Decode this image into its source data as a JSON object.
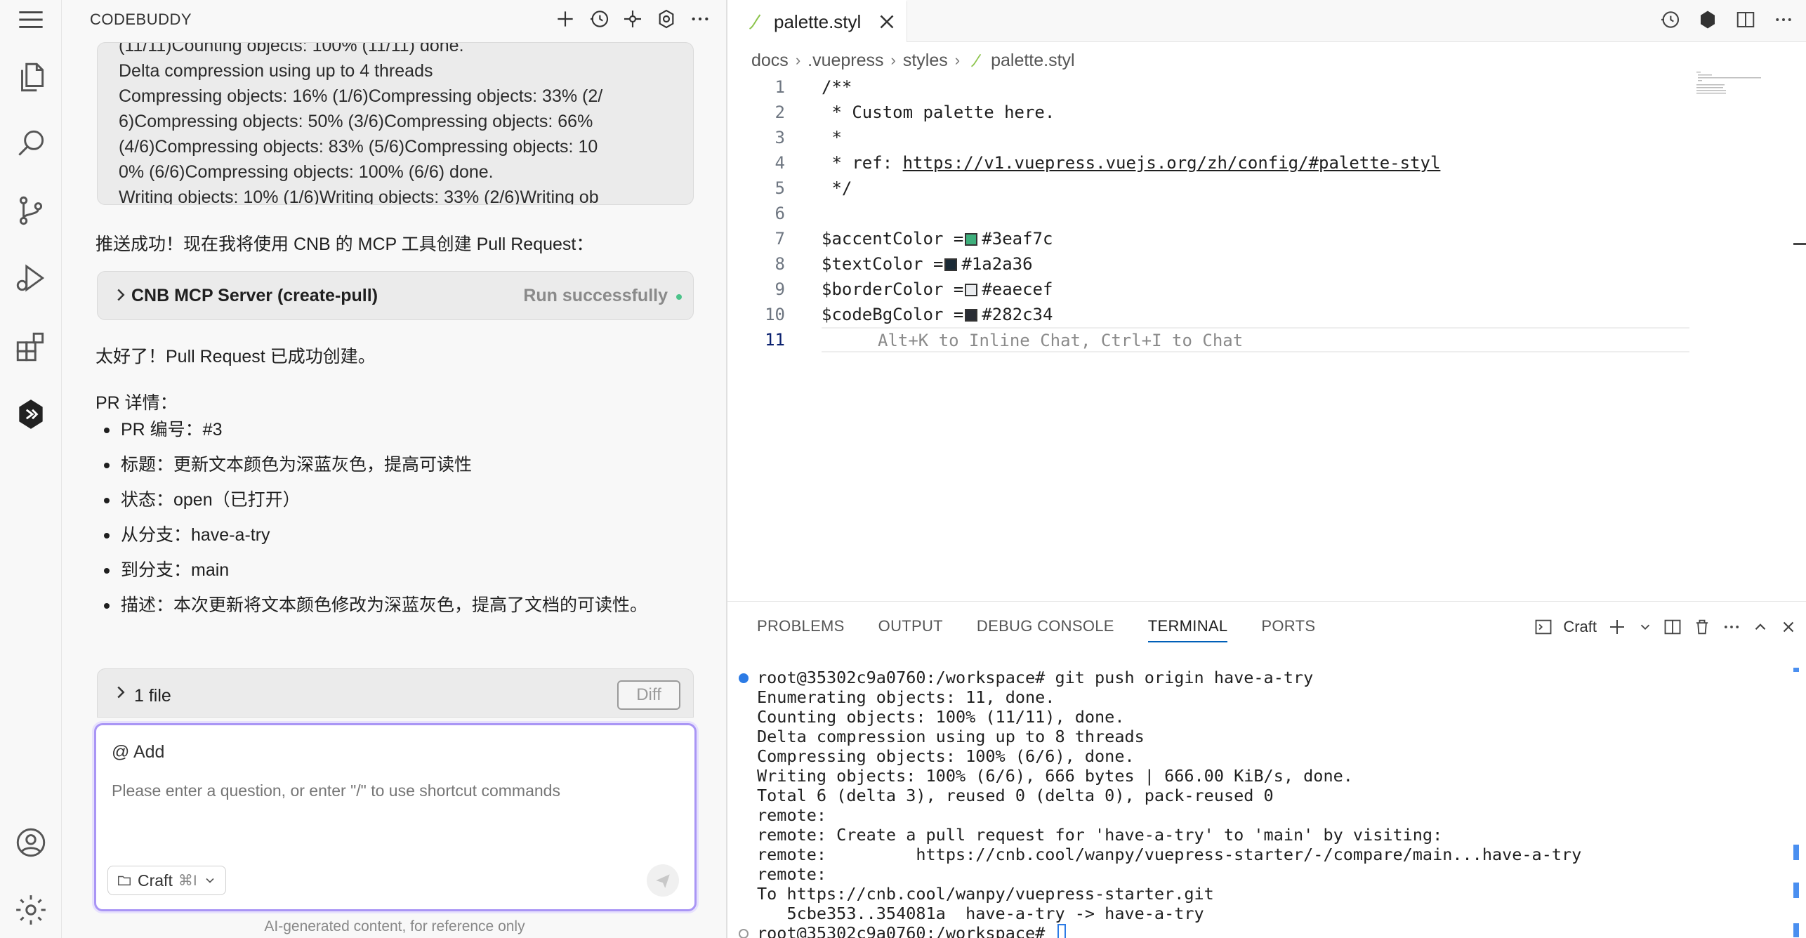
{
  "activity_bar": {
    "icons": [
      "menu-icon",
      "explorer-icon",
      "search-icon",
      "source-control-icon",
      "run-debug-icon",
      "extensions-icon",
      "codebuddy-icon",
      "account-icon",
      "settings-icon"
    ]
  },
  "chat": {
    "title": "CODEBUDDY",
    "header_icons": [
      "add-icon",
      "history-icon",
      "mcp-icon",
      "settings-icon",
      "more-icon"
    ],
    "git_output_lines": [
      "(11/11)Counting objects: 100% (11/11) done.",
      "Delta compression using up to 4 threads",
      "Compressing objects:  16% (1/6)Compressing objects:  33% (2/",
      "6)Compressing objects:  50% (3/6)Compressing objects:  66%",
      "(4/6)Compressing objects:  83% (5/6)Compressing objects: 10",
      "0% (6/6)Compressing objects: 100% (6/6) done.",
      "Writing objects:  10% (1/6)Writing objects:  33% (2/6)Writing ob"
    ],
    "push_message": "推送成功！现在我将使用 CNB 的 MCP 工具创建 Pull Request：",
    "tool_call": {
      "name": "CNB MCP Server (create-pull)",
      "status": "Run successfully"
    },
    "success_message": "太好了！Pull Request 已成功创建。",
    "pr_heading": "PR 详情：",
    "pr_details": [
      "PR 编号：#3",
      "标题：更新文本颜色为深蓝灰色，提高可读性",
      "状态：open（已打开）",
      "从分支：have-a-try",
      "到分支：main",
      "描述：本次更新将文本颜色修改为深蓝灰色，提高了文档的可读性。"
    ],
    "files": {
      "label": "1 file",
      "diff_button": "Diff"
    },
    "input": {
      "add_label": "@ Add",
      "placeholder": "Please enter a question, or enter \"/\" to use shortcut commands",
      "mode": "Craft",
      "mode_shortcut": "⌘I"
    },
    "disclaimer": "AI-generated content, for reference only"
  },
  "editor": {
    "tab": {
      "name": "palette.styl"
    },
    "breadcrumb": [
      "docs",
      ".vuepress",
      "styles",
      "palette.styl"
    ],
    "lines": [
      {
        "n": "1",
        "text": "/**"
      },
      {
        "n": "2",
        "text": " * Custom palette here."
      },
      {
        "n": "3",
        "text": " *"
      },
      {
        "n": "4",
        "prefix": " * ref: ",
        "link": "https://v1.vuepress.vuejs.org/zh/config/#palette-styl"
      },
      {
        "n": "5",
        "text": " */"
      },
      {
        "n": "6",
        "text": ""
      },
      {
        "n": "7",
        "var": "$accentColor =",
        "color": "#3eaf7c"
      },
      {
        "n": "8",
        "var": "$textColor =",
        "color": "#1a2a36"
      },
      {
        "n": "9",
        "var": "$borderColor =",
        "color": "#eaecef"
      },
      {
        "n": "10",
        "var": "$codeBgColor =",
        "color": "#282c34"
      },
      {
        "n": "11",
        "text": ""
      }
    ],
    "inline_hint": "Alt+K to Inline Chat, Ctrl+I to Chat"
  },
  "panel": {
    "tabs": [
      "PROBLEMS",
      "OUTPUT",
      "DEBUG CONSOLE",
      "TERMINAL",
      "PORTS"
    ],
    "active_tab": "TERMINAL",
    "terminal_name": "Craft",
    "terminal_lines": [
      "root@35302c9a0760:/workspace# git push origin have-a-try",
      "Enumerating objects: 11, done.",
      "Counting objects: 100% (11/11), done.",
      "Delta compression using up to 8 threads",
      "Compressing objects: 100% (6/6), done.",
      "Writing objects: 100% (6/6), 666 bytes | 666.00 KiB/s, done.",
      "Total 6 (delta 3), reused 0 (delta 0), pack-reused 0",
      "remote:",
      "remote: Create a pull request for 'have-a-try' to 'main' by visiting:",
      "remote:         https://cnb.cool/wanpy/vuepress-starter/-/compare/main...have-a-try",
      "remote:",
      "To https://cnb.cool/wanpy/vuepress-starter.git",
      "   5cbe353..354081a  have-a-try -> have-a-try",
      "root@35302c9a0760:/workspace# "
    ]
  },
  "colors": {
    "accent": "#a995f5",
    "terminal_active": "#005fb8",
    "success_dot": "#4cc38a"
  }
}
